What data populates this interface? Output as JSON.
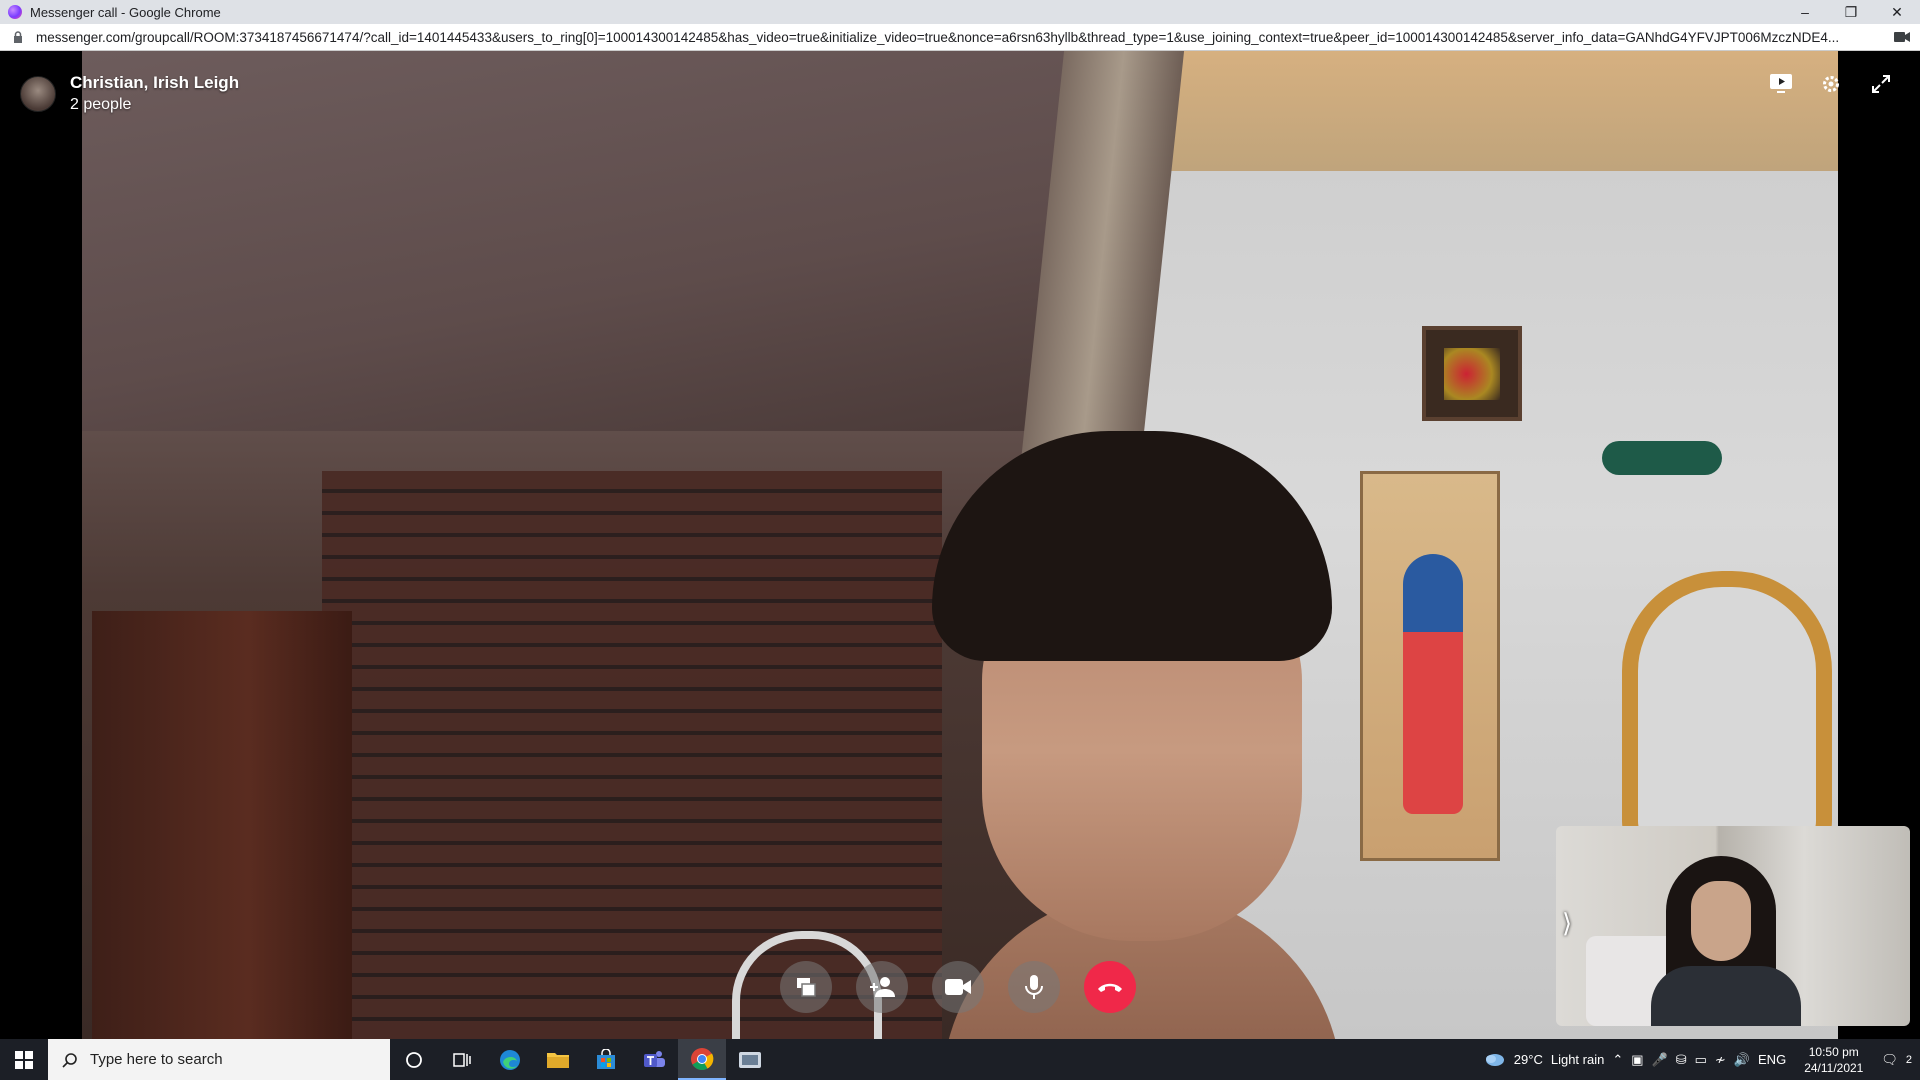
{
  "window": {
    "title": "Messenger call - Google Chrome",
    "url": "messenger.com/groupcall/ROOM:3734187456671474/?call_id=1401445433&users_to_ring[0]=100014300142485&has_video=true&initialize_video=true&nonce=a6rsn63hyllb&thread_type=1&use_joining_context=true&peer_id=100014300142485&server_info_data=GANhdG4YFVJPT006MzczNDE4..."
  },
  "call": {
    "name": "Christian, Irish Leigh",
    "participants": "2 people"
  },
  "taskbar": {
    "search_placeholder": "Type here to search",
    "weather_temp": "29°C",
    "weather_desc": "Light rain",
    "language": "ENG",
    "time": "10:50 pm",
    "date": "24/11/2021",
    "notification_count": "2"
  },
  "colors": {
    "end_call": "#f02849",
    "taskbar_bg": "#1c1f26"
  }
}
